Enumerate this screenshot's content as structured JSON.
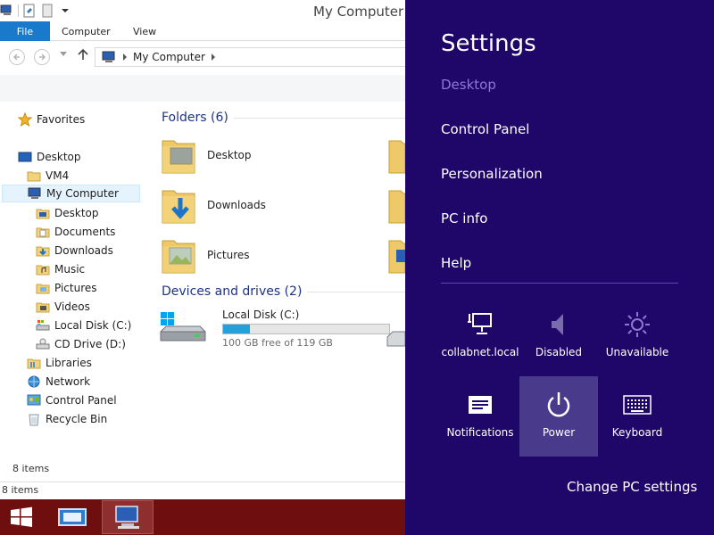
{
  "window": {
    "title": "My Computer",
    "tabs": {
      "file": "File",
      "computer": "Computer",
      "view": "View"
    },
    "address": {
      "breadcrumb": "My Computer"
    }
  },
  "nav_pane": {
    "favorites": "Favorites",
    "desktop": "Desktop",
    "vm4": "VM4",
    "my_computer": "My Computer",
    "children": [
      "Desktop",
      "Documents",
      "Downloads",
      "Music",
      "Pictures",
      "Videos",
      "Local Disk (C:)",
      "CD Drive (D:)"
    ],
    "libraries": "Libraries",
    "network": "Network",
    "control_panel": "Control Panel",
    "recycle_bin": "Recycle Bin"
  },
  "content": {
    "folders_header": "Folders (6)",
    "folders": [
      "Desktop",
      "Downloads",
      "Pictures"
    ],
    "devices_header": "Devices and drives (2)",
    "drive": {
      "name": "Local Disk (C:)",
      "free_text": "100 GB free of 119 GB",
      "used_fraction": 0.16
    }
  },
  "status": {
    "items_inner": "8 items",
    "items_bar": "8 items"
  },
  "charm": {
    "title": "Settings",
    "context": "Desktop",
    "links": [
      "Control Panel",
      "Personalization",
      "PC info",
      "Help"
    ],
    "tiles": {
      "network": "collabnet.local",
      "volume": "Disabled",
      "brightness": "Unavailable",
      "notifications": "Notifications",
      "power": "Power",
      "keyboard": "Keyboard"
    },
    "change_settings": "Change PC settings"
  },
  "colors": {
    "charm_bg": "#1f0769",
    "charm_context": "#8a78d6",
    "taskbar": "#6e0e0e",
    "file_tab": "#1979ca",
    "group_header": "#1e3287",
    "drive_bar_fill": "#26a0da"
  }
}
